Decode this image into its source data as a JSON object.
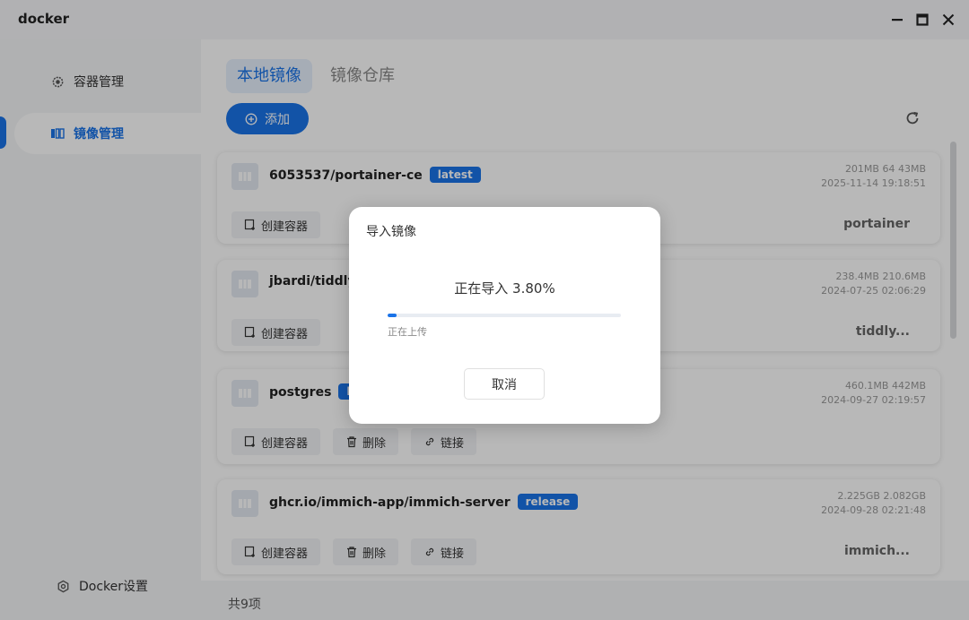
{
  "window": {
    "title": "docker"
  },
  "sidebar": {
    "items": [
      {
        "label": "容器管理",
        "icon": "container-gear-icon"
      },
      {
        "label": "镜像管理",
        "icon": "image-stack-icon"
      }
    ],
    "footer_label": "Docker设置"
  },
  "main": {
    "tabs": [
      {
        "label": "本地镜像"
      },
      {
        "label": "镜像仓库"
      }
    ],
    "add_label": "添加",
    "images": [
      {
        "name": "6053537/portainer-ce",
        "tag": "latest",
        "size": "201MB 64 43MB",
        "date": "2025-11-14 19:18:51",
        "label": "portainer",
        "actions": [
          "创建容器"
        ]
      },
      {
        "name": "jbardi/tiddlyw",
        "tag": "",
        "size": "238.4MB 210.6MB",
        "date": "2024-07-25 02:06:29",
        "label": "tiddly...",
        "actions": [
          "创建容器"
        ]
      },
      {
        "name": "postgres",
        "tag": "lat",
        "size": "460.1MB 442MB",
        "date": "2024-09-27 02:19:57",
        "label": "",
        "actions": [
          "创建容器",
          "删除",
          "链接"
        ]
      },
      {
        "name": "ghcr.io/immich-app/immich-server",
        "tag": "release",
        "size": "2.225GB 2.082GB",
        "date": "2024-09-28 02:21:48",
        "label": "immich...",
        "actions": [
          "创建容器",
          "删除",
          "链接"
        ]
      }
    ],
    "footer_count": "共9项"
  },
  "dialog": {
    "title": "导入镜像",
    "status": "正在导入 3.80%",
    "progress": 0.038,
    "sub": "正在上传",
    "cancel_label": "取消"
  },
  "colors": {
    "accent": "#1a73e8"
  }
}
